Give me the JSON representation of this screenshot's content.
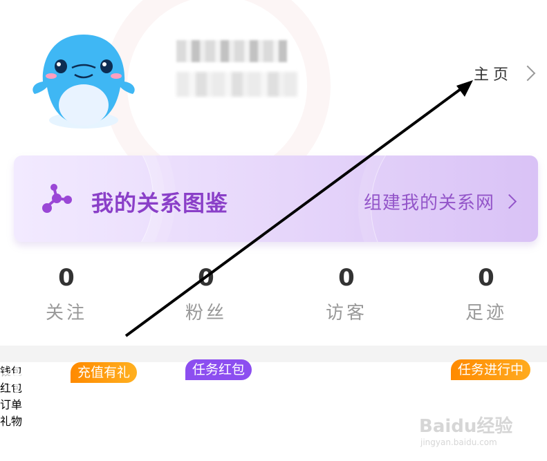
{
  "profile": {
    "homepage_label": "主页"
  },
  "relation_card": {
    "title": "我的关系图鉴",
    "action": "组建我的关系网"
  },
  "stats": [
    {
      "value": "0",
      "label": "关注"
    },
    {
      "value": "0",
      "label": "粉丝"
    },
    {
      "value": "0",
      "label": "访客"
    },
    {
      "value": "0",
      "label": "足迹"
    }
  ],
  "tools": [
    {
      "label": "钱包",
      "badge": "充值有礼",
      "icon": "wallet-icon"
    },
    {
      "label": "红包",
      "badge": "任务红包",
      "icon": "red-packet-icon"
    },
    {
      "label": "订单",
      "badge": "",
      "icon": "order-icon"
    },
    {
      "label": "礼物",
      "badge": "任务进行中",
      "icon": "gift-icon"
    }
  ],
  "watermark": {
    "brand": "Baidu经验",
    "url": "jingyan.baidu.com"
  },
  "colors": {
    "accent_purple": "#8a3fc8",
    "badge_orange": "#ff9a1a",
    "badge_purple": "#8b5cf6",
    "wallet": "#ff6a3d",
    "red_packet": "#ff4d6d",
    "order": "#29a8f5",
    "gift": "#ff3d7f"
  }
}
